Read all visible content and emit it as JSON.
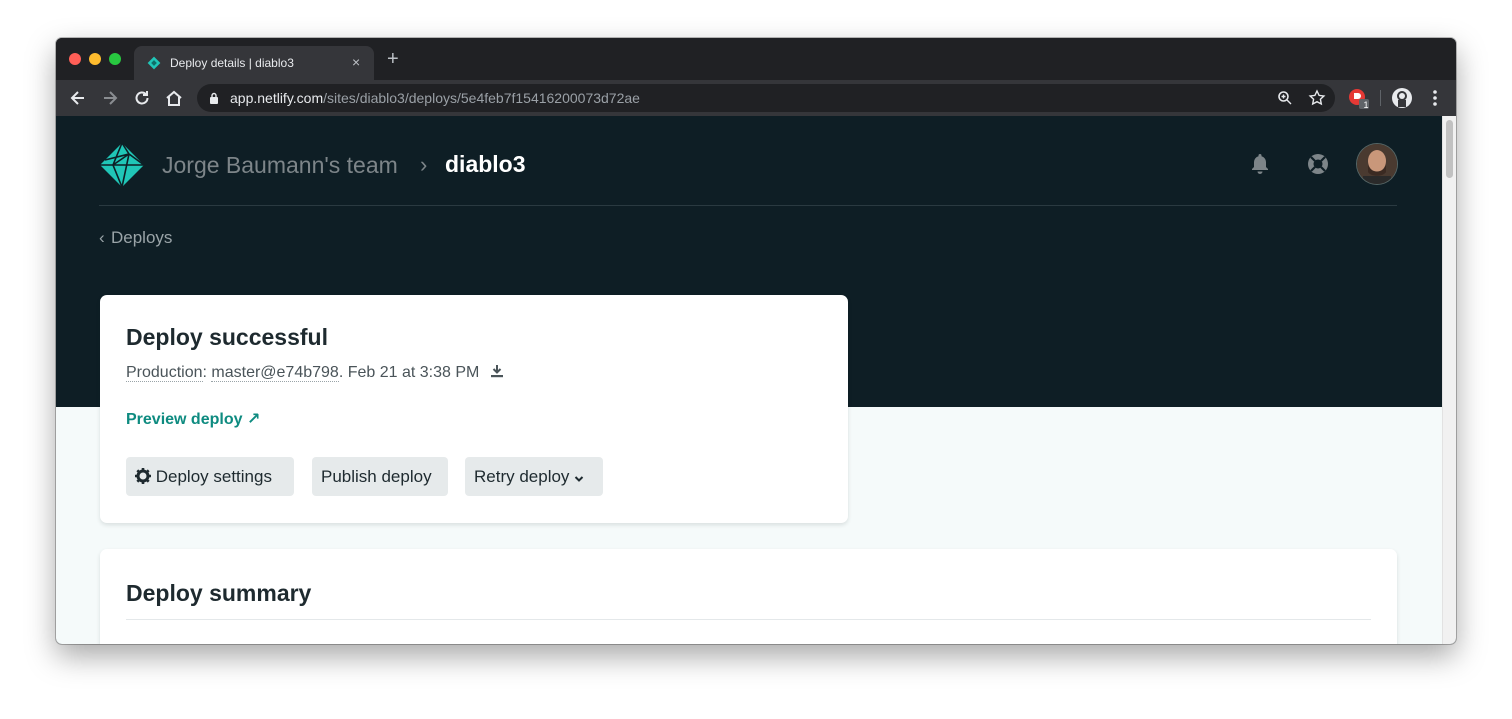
{
  "browser": {
    "tab": {
      "title": "Deploy details | diablo3",
      "close_glyph": "×"
    },
    "new_tab_glyph": "+",
    "url": {
      "host": "app.netlify.com",
      "path": "/sites/diablo3/deploys/5e4feb7f15416200073d72ae"
    },
    "extension_badge": "1"
  },
  "header": {
    "team": "Jorge Baumann's team",
    "separator": "›",
    "site": "diablo3",
    "back_label": "Deploys",
    "back_chevron": "‹"
  },
  "deploy_card": {
    "title": "Deploy successful",
    "context": "Production",
    "branch_commit": "master@e74b798",
    "time": ". Feb 21 at 3:38 PM",
    "preview_label": "Preview deploy",
    "preview_arrow": "↗",
    "buttons": {
      "settings": "Deploy settings",
      "publish": "Publish deploy",
      "retry": "Retry deploy"
    }
  },
  "summary": {
    "title": "Deploy summary"
  },
  "colors": {
    "hero_bg": "#0e1e25",
    "page_bg": "#f5fafa",
    "accent_teal": "#0e8b80",
    "button_bg": "#e6eaeb"
  },
  "icons": [
    "netlify-logo",
    "bell-icon",
    "lifebuoy-icon",
    "download-icon",
    "gear-icon",
    "chevron-down-icon",
    "lock-icon",
    "zoom-icon",
    "star-icon",
    "profile-icon",
    "kebab-menu-icon"
  ]
}
